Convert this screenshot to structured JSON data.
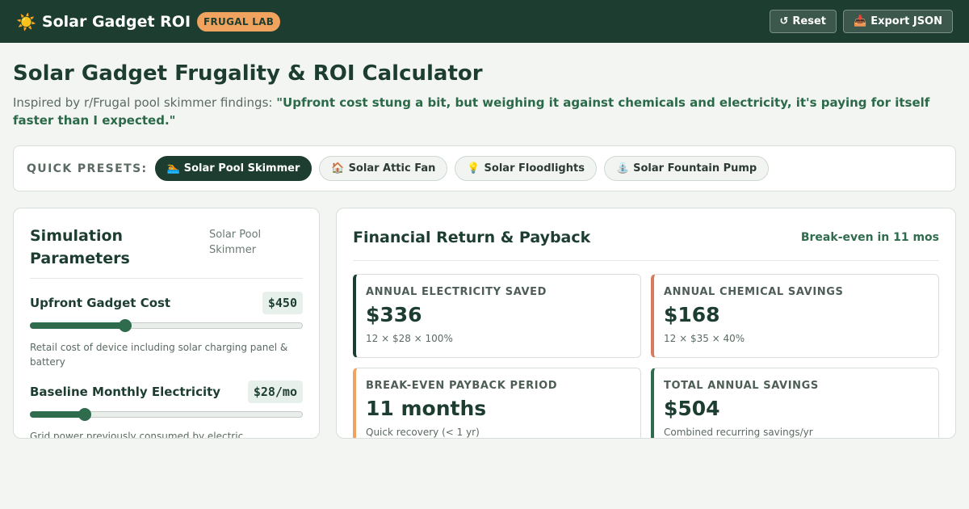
{
  "header": {
    "icon": "sun-icon",
    "icon_glyph": "☀️",
    "title": "Solar Gadget ROI",
    "badge": "FRUGAL LAB",
    "actions": [
      {
        "icon": "reset-icon",
        "glyph": "↺",
        "label": "Reset"
      },
      {
        "icon": "inbox-tray-icon",
        "glyph": "📥",
        "label": "Export JSON"
      }
    ]
  },
  "page": {
    "title": "Solar Gadget Frugality & ROI Calculator",
    "subtitle_prefix": "Inspired by r/Frugal pool skimmer findings: ",
    "subtitle_quote": "\"Upfront cost stung a bit, but weighing it against chemicals and electricity, it's paying for itself faster than I expected.\""
  },
  "presets": {
    "label": "QUICK PRESETS:",
    "items": [
      {
        "icon": "swimmer-icon",
        "glyph": "🏊",
        "label": "Solar Pool Skimmer",
        "active": true
      },
      {
        "icon": "house-icon",
        "glyph": "🏠",
        "label": "Solar Attic Fan",
        "active": false
      },
      {
        "icon": "light-bulb-icon",
        "glyph": "💡",
        "label": "Solar Floodlights",
        "active": false
      },
      {
        "icon": "fountain-icon",
        "glyph": "⛲",
        "label": "Solar Fountain Pump",
        "active": false
      }
    ]
  },
  "parameters": {
    "title": "Simulation Parameters",
    "preset_name": "Solar Pool Skimmer",
    "items": [
      {
        "label": "Upfront Gadget Cost",
        "value": "$450",
        "level": 0.35,
        "description": "Retail cost of device including solar charging panel & battery"
      },
      {
        "label": "Baseline Monthly Electricity",
        "value": "$28/mo",
        "level": 0.2,
        "description": "Grid power previously consumed by electric"
      }
    ]
  },
  "results": {
    "title": "Financial Return & Payback",
    "status": "Break-even in 11 mos",
    "metrics": [
      {
        "label": "ANNUAL ELECTRICITY SAVED",
        "value": "$336",
        "sub": "12 × $28 × 100%",
        "accent": "#1c3d30"
      },
      {
        "label": "ANNUAL CHEMICAL SAVINGS",
        "value": "$168",
        "sub": "12 × $35 × 40%",
        "accent": "#d97a5f"
      },
      {
        "label": "BREAK-EVEN PAYBACK PERIOD",
        "value": "11 months",
        "sub": "Quick recovery (< 1 yr)",
        "accent": "#f0a35e"
      },
      {
        "label": "TOTAL ANNUAL SAVINGS",
        "value": "$504",
        "sub": "Combined recurring savings/yr",
        "accent": "#2f6b4d"
      }
    ]
  },
  "colors": {
    "topbar": "#1c3d30",
    "accent_green": "#2f6b4d",
    "badge_orange": "#f0a35e"
  }
}
